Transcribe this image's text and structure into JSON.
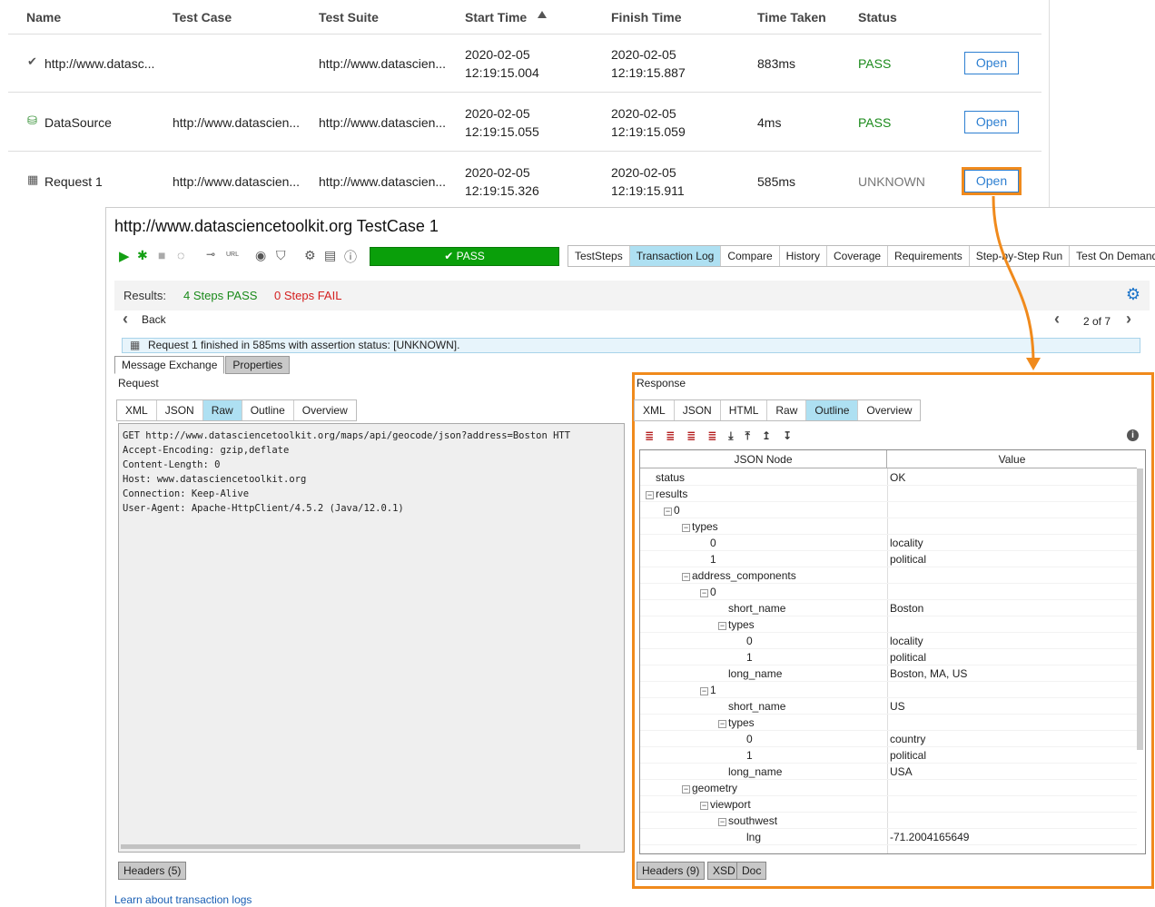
{
  "table": {
    "headers": [
      "Name",
      "Test Case",
      "Test Suite",
      "Start Time",
      "Finish Time",
      "Time Taken",
      "Status"
    ],
    "rows": [
      {
        "icon": "check-icon",
        "name": "http://www.datasc...",
        "test_case": "",
        "test_suite": "http://www.datascien...",
        "start_date": "2020-02-05",
        "start_time": "12:19:15.004",
        "finish_date": "2020-02-05",
        "finish_time": "12:19:15.887",
        "time_taken": "883ms",
        "status": "PASS",
        "action": "Open"
      },
      {
        "icon": "datasource-icon",
        "name": "DataSource",
        "test_case": "http://www.datascien...",
        "test_suite": "http://www.datascien...",
        "start_date": "2020-02-05",
        "start_time": "12:19:15.055",
        "finish_date": "2020-02-05",
        "finish_time": "12:19:15.059",
        "time_taken": "4ms",
        "status": "PASS",
        "action": "Open"
      },
      {
        "icon": "request-icon",
        "name": "Request 1",
        "test_case": "http://www.datascien...",
        "test_suite": "http://www.datascien...",
        "start_date": "2020-02-05",
        "start_time": "12:19:15.326",
        "finish_date": "2020-02-05",
        "finish_time": "12:19:15.911",
        "time_taken": "585ms",
        "status": "UNKNOWN",
        "action": "Open"
      }
    ]
  },
  "testcase": {
    "title": "http://www.datasciencetoolkit.org TestCase 1",
    "run_status": "PASS",
    "toolbar_url_label": "URL",
    "tabs": [
      "TestSteps",
      "Transaction Log",
      "Compare",
      "History",
      "Coverage",
      "Requirements",
      "Step-by-Step Run",
      "Test On Demand"
    ],
    "active_tab": "Transaction Log"
  },
  "results": {
    "label": "Results:",
    "pass_text": "4 Steps PASS",
    "fail_text": "0 Steps FAIL"
  },
  "nav": {
    "back_label": "Back",
    "pager": "2 of 7"
  },
  "info_message": "Request 1 finished in 585ms with assertion status: [UNKNOWN].",
  "sub_tabs": [
    "Message Exchange",
    "Properties"
  ],
  "request": {
    "label": "Request",
    "tabs": [
      "XML",
      "JSON",
      "Raw",
      "Outline",
      "Overview"
    ],
    "active_tab": "Raw",
    "raw": "GET http://www.datasciencetoolkit.org/maps/api/geocode/json?address=Boston HTT\nAccept-Encoding: gzip,deflate\nContent-Length: 0\nHost: www.datasciencetoolkit.org\nConnection: Keep-Alive\nUser-Agent: Apache-HttpClient/4.5.2 (Java/12.0.1)",
    "headers_button": "Headers (5)"
  },
  "response": {
    "label": "Response",
    "tabs": [
      "XML",
      "JSON",
      "HTML",
      "Raw",
      "Outline",
      "Overview"
    ],
    "active_tab": "Outline",
    "col_node": "JSON Node",
    "col_value": "Value",
    "tree": [
      {
        "depth": 0,
        "node": "status",
        "value": "OK",
        "toggle": ""
      },
      {
        "depth": 0,
        "node": "results",
        "value": "",
        "toggle": "−"
      },
      {
        "depth": 1,
        "node": "0",
        "value": "",
        "toggle": "−"
      },
      {
        "depth": 2,
        "node": "types",
        "value": "",
        "toggle": "−"
      },
      {
        "depth": 3,
        "node": "0",
        "value": "locality",
        "toggle": ""
      },
      {
        "depth": 3,
        "node": "1",
        "value": "political",
        "toggle": ""
      },
      {
        "depth": 2,
        "node": "address_components",
        "value": "",
        "toggle": "−"
      },
      {
        "depth": 3,
        "node": "0",
        "value": "",
        "toggle": "−"
      },
      {
        "depth": 4,
        "node": "short_name",
        "value": "Boston",
        "toggle": ""
      },
      {
        "depth": 4,
        "node": "types",
        "value": "",
        "toggle": "−"
      },
      {
        "depth": 5,
        "node": "0",
        "value": "locality",
        "toggle": ""
      },
      {
        "depth": 5,
        "node": "1",
        "value": "political",
        "toggle": ""
      },
      {
        "depth": 4,
        "node": "long_name",
        "value": "Boston, MA, US",
        "toggle": ""
      },
      {
        "depth": 3,
        "node": "1",
        "value": "",
        "toggle": "−"
      },
      {
        "depth": 4,
        "node": "short_name",
        "value": "US",
        "toggle": ""
      },
      {
        "depth": 4,
        "node": "types",
        "value": "",
        "toggle": "−"
      },
      {
        "depth": 5,
        "node": "0",
        "value": "country",
        "toggle": ""
      },
      {
        "depth": 5,
        "node": "1",
        "value": "political",
        "toggle": ""
      },
      {
        "depth": 4,
        "node": "long_name",
        "value": "USA",
        "toggle": ""
      },
      {
        "depth": 2,
        "node": "geometry",
        "value": "",
        "toggle": "−"
      },
      {
        "depth": 3,
        "node": "viewport",
        "value": "",
        "toggle": "−"
      },
      {
        "depth": 4,
        "node": "southwest",
        "value": "",
        "toggle": "−"
      },
      {
        "depth": 5,
        "node": "lng",
        "value": "-71.2004165649",
        "toggle": ""
      }
    ],
    "footer_buttons": [
      "Headers (9)",
      "XSD",
      "Doc"
    ]
  },
  "learn_link": "Learn about transaction logs",
  "colors": {
    "accent": "#2d7fd1",
    "highlight": "#f08a1c",
    "pass": "#1a8a1a",
    "fail": "#d42020",
    "active_tab": "#aee0f2"
  }
}
